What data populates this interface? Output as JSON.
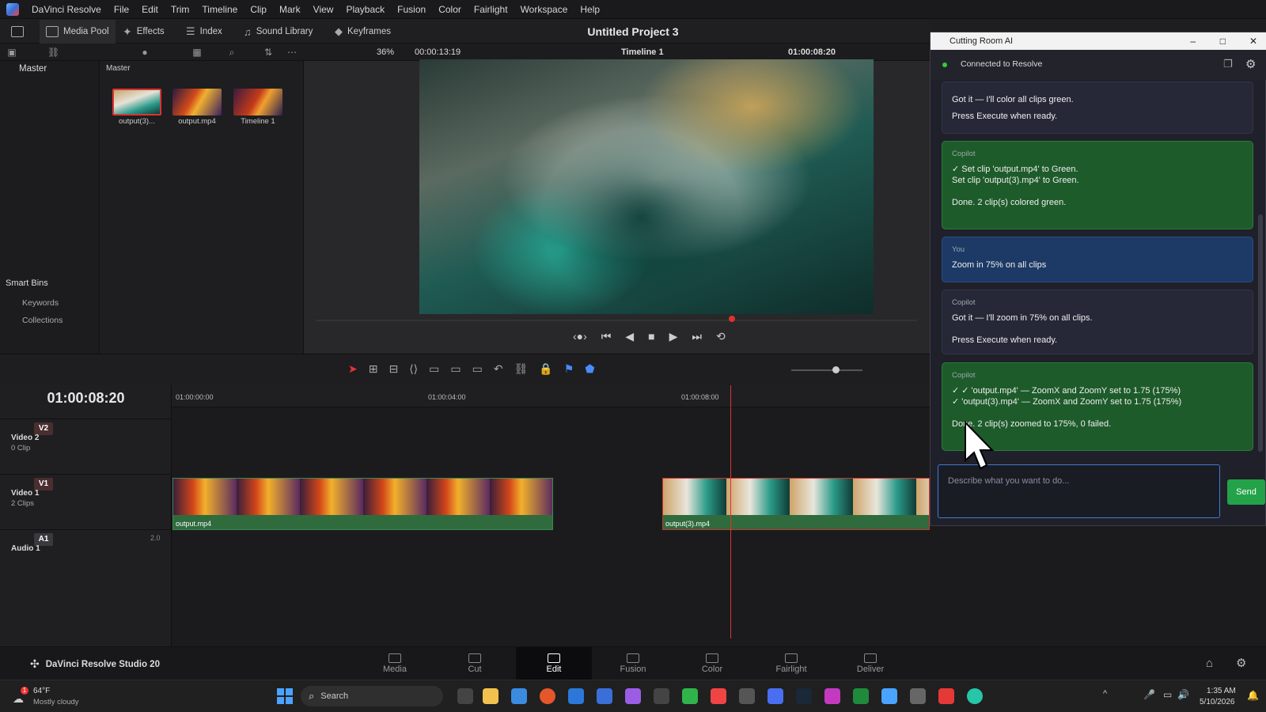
{
  "menubar": {
    "items": [
      "DaVinci Resolve",
      "File",
      "Edit",
      "Trim",
      "Timeline",
      "Clip",
      "Mark",
      "View",
      "Playback",
      "Fusion",
      "Color",
      "Fairlight",
      "Workspace",
      "Help"
    ]
  },
  "toolbar": {
    "media_pool": "Media Pool",
    "effects": "Effects",
    "index": "Index",
    "sound_library": "Sound Library",
    "keyframes": "Keyframes",
    "project_title": "Untitled Project 3"
  },
  "viewer": {
    "zoom": "36%",
    "duration": "00:00:13:19",
    "timeline_name": "Timeline 1",
    "timecode": "01:00:08:20"
  },
  "bins": {
    "master_left": "Master",
    "master_right": "Master",
    "smart_bins": "Smart Bins",
    "keywords": "Keywords",
    "collections": "Collections"
  },
  "media": [
    {
      "name": "output(3)..."
    },
    {
      "name": "output.mp4"
    },
    {
      "name": "Timeline 1"
    }
  ],
  "timeline": {
    "timecode": "01:00:08:20",
    "ruler": [
      "01:00:00:00",
      "01:00:04:00",
      "01:00:08:00"
    ],
    "tracks": [
      {
        "tag": "V2",
        "name": "Video 2",
        "sub": "0 Clip"
      },
      {
        "tag": "V1",
        "name": "Video 1",
        "sub": "2 Clips"
      },
      {
        "tag": "A1",
        "name": "Audio 1",
        "sub": "",
        "level": "2.0"
      }
    ],
    "clips": [
      {
        "label": "output.mp4"
      },
      {
        "label": "output(3).mp4"
      }
    ]
  },
  "pages": [
    "Media",
    "Cut",
    "Edit",
    "Fusion",
    "Color",
    "Fairlight",
    "Deliver"
  ],
  "selected_page": "Edit",
  "studio": "DaVinci Resolve Studio 20",
  "ai": {
    "title": "Cutting Room AI",
    "status": "Connected to Resolve",
    "messages": [
      {
        "who": "Copilot",
        "lines": [
          "Got it — I'll color all clips green.",
          "Press Execute when ready."
        ]
      },
      {
        "who": "Copilot",
        "lines": [
          "✓ Set clip 'output.mp4' to Green.",
          "Set clip 'output(3).mp4' to Green.",
          "Done. 2 clip(s) colored green."
        ]
      },
      {
        "who": "You",
        "lines": [
          "Zoom in 75% on all clips"
        ]
      },
      {
        "who": "Copilot",
        "lines": [
          "Got it — I'll zoom in 75% on all clips.",
          "Press Execute when ready."
        ]
      },
      {
        "who": "Copilot",
        "lines": [
          "✓ ✓ 'output.mp4' — ZoomX and ZoomY set to 1.75 (175%)",
          "✓ 'output(3).mp4' — ZoomX and ZoomY set to 1.75 (175%)",
          "Done. 2 clip(s) zoomed to 175%, 0 failed."
        ]
      }
    ],
    "placeholder": "Describe what you want to do...",
    "send": "Send"
  },
  "taskbar": {
    "weather_temp": "64°F",
    "weather_desc": "Mostly cloudy",
    "search": "Search",
    "time": "1:35 AM",
    "date": "5/10/2026",
    "notif": "1"
  }
}
